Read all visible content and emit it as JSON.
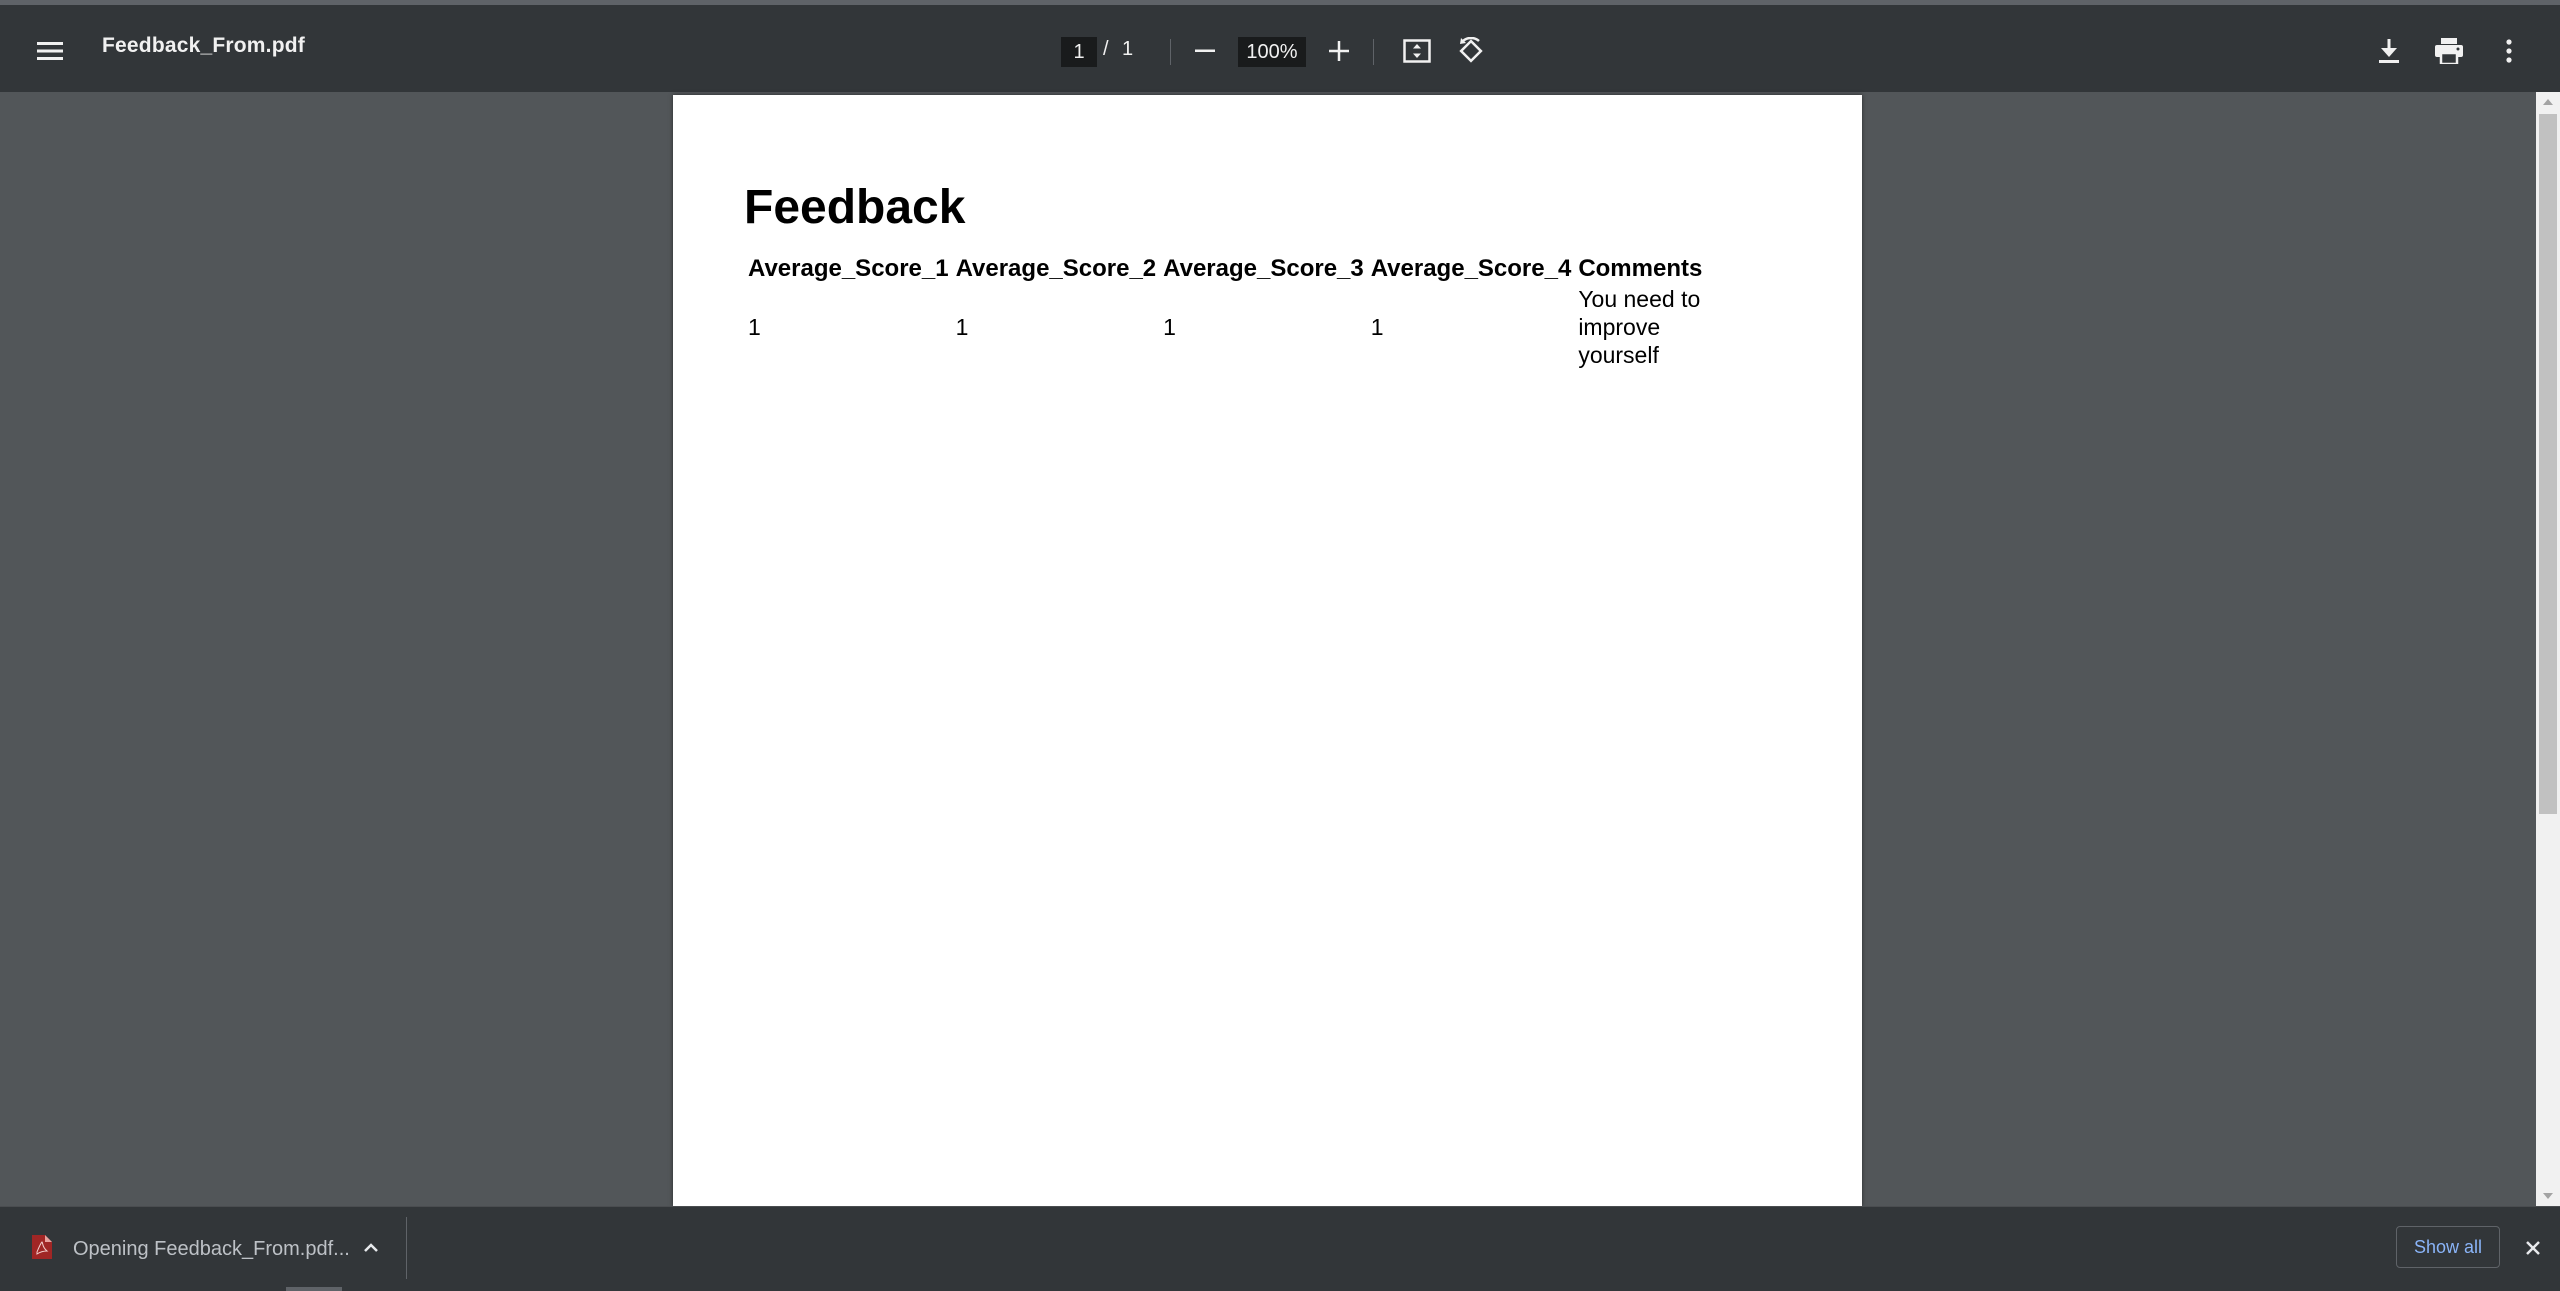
{
  "toolbar": {
    "title": "Feedback_From.pdf",
    "page_current": "1",
    "page_separator": "/",
    "page_total": "1",
    "zoom": "100%",
    "icons": {
      "menu": "menu-icon",
      "zoom_out": "minus-icon",
      "zoom_in": "plus-icon",
      "fit": "fit-to-page-icon",
      "rotate": "rotate-icon",
      "download": "download-icon",
      "print": "print-icon",
      "more": "more-vert-icon"
    }
  },
  "document": {
    "heading": "Feedback",
    "table": {
      "headers": [
        "Average_Score_1",
        "Average_Score_2",
        "Average_Score_3",
        "Average_Score_4",
        "Comments"
      ],
      "rows": [
        [
          "1",
          "1",
          "1",
          "1",
          "You need to improve yourself"
        ]
      ]
    }
  },
  "download_shelf": {
    "item_label": "Opening Feedback_From.pdf...",
    "show_all_label": "Show all",
    "icons": {
      "file": "pdf-file-icon",
      "chevron": "chevron-up-icon",
      "close": "close-icon"
    }
  },
  "colors": {
    "toolbar_bg": "#323639",
    "viewer_bg": "#525659",
    "page_bg": "#ffffff",
    "link_blue": "#8ab4f8"
  }
}
